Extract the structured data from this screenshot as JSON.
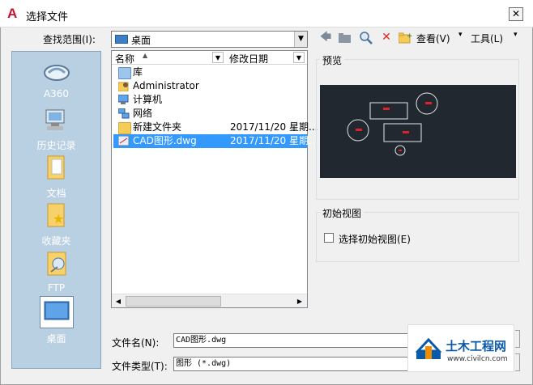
{
  "window": {
    "title": "选择文件",
    "close": "✕"
  },
  "toolbar": {
    "look_in_label": "查找范围(I):",
    "look_in_value": "桌面",
    "view_label": "查看(V)",
    "tools_label": "工具(L)"
  },
  "places": [
    {
      "label": "A360"
    },
    {
      "label": "历史记录"
    },
    {
      "label": "文档"
    },
    {
      "label": "收藏夹"
    },
    {
      "label": "FTP"
    },
    {
      "label": "桌面"
    }
  ],
  "file_list": {
    "columns": [
      "名称",
      "修改日期"
    ],
    "rows": [
      {
        "name": "库",
        "date": ""
      },
      {
        "name": "Administrator",
        "date": ""
      },
      {
        "name": "计算机",
        "date": ""
      },
      {
        "name": "网络",
        "date": ""
      },
      {
        "name": "新建文件夹",
        "date": "2017/11/20 星期..."
      },
      {
        "name": "CAD图形.dwg",
        "date": "2017/11/20 星期..."
      }
    ]
  },
  "preview": {
    "label": "预览",
    "background": "#212830"
  },
  "initial_view": {
    "label": "初始视图",
    "checkbox_label": "选择初始视图(E)",
    "checked": false
  },
  "file_name": {
    "label": "文件名(N):",
    "value": "CAD图形.dwg"
  },
  "file_type": {
    "label": "文件类型(T):",
    "value": "图形 (*.dwg)"
  },
  "watermark": {
    "brand": "土木工程网",
    "url": "www.civilcn.com"
  }
}
